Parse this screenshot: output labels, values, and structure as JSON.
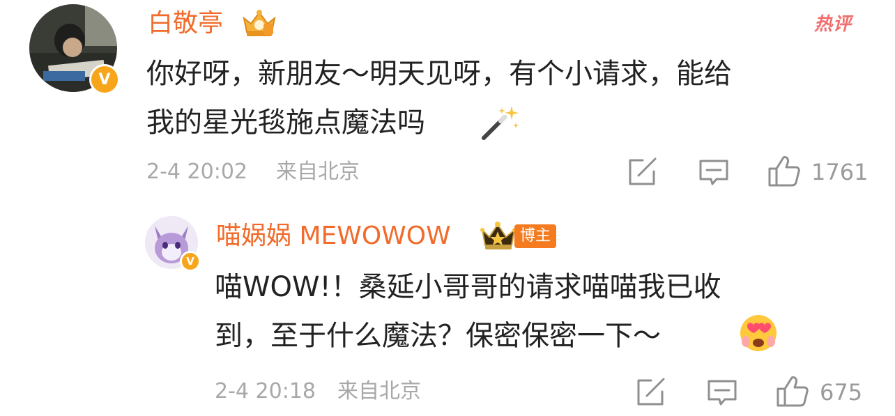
{
  "comment": {
    "username": "白敬亭",
    "hot_label": "热评",
    "text_line1": "你好呀，新朋友～明天见呀，有个小请求，能给",
    "text_line2": "我的星光毯施点魔法吗",
    "time": "2-4 20:02",
    "location": "来自北京",
    "like_count": "1761",
    "icons": [
      "avatar",
      "verified-badge-icon",
      "crown-badge-icon",
      "magic-wand-emoji",
      "share-icon",
      "comment-icon",
      "like-icon"
    ],
    "colors": {
      "name": "#f26b2a",
      "text": "#222222",
      "meta": "#a8a8a8",
      "hot": "#f26d6d",
      "verified": "#f7a51a"
    }
  },
  "reply": {
    "username": "喵娲娲 MEWOWOW",
    "blogger_label": "博主",
    "text_line1": "喵WOW!！桑延小哥哥的请求喵喵我已收",
    "text_line2": "到，至于什么魔法？保密保密一下～",
    "time": "2-4 20:18",
    "location": "来自北京",
    "like_count": "675",
    "icons": [
      "avatar",
      "verified-badge-icon",
      "crown-badge-icon",
      "heart-eyes-emoji",
      "share-icon",
      "comment-icon",
      "like-icon"
    ]
  }
}
